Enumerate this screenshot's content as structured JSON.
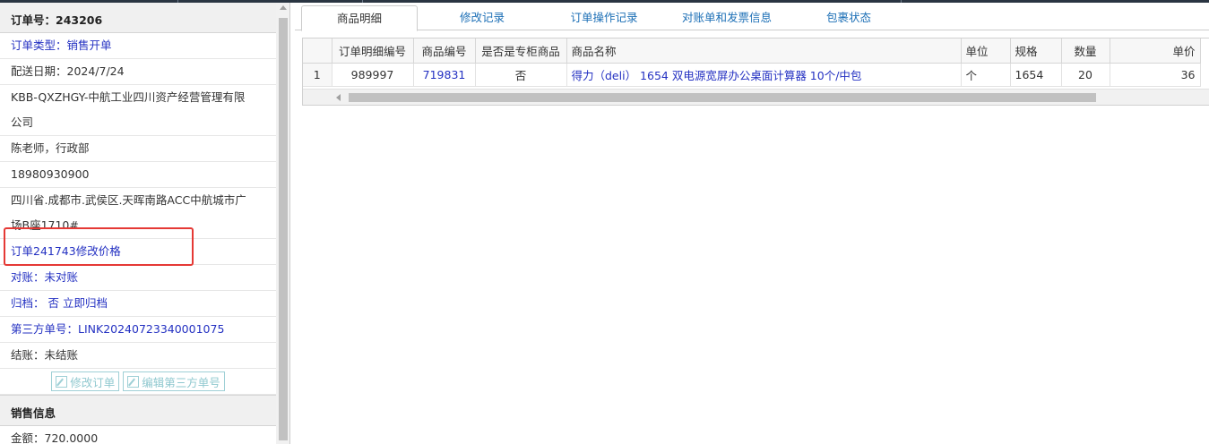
{
  "order": {
    "title": "订单号：243206",
    "type_label": "订单类型：销售开单",
    "delivery_date": "配送日期：2024/7/24",
    "customer_line1": "KBB-QXZHGY-中航工业四川资产经营管理有限",
    "customer_line2": "公司",
    "contact": "陈老师，行政部",
    "phone": "18980930900",
    "address_line1": "四川省.成都市.武侯区.天晖南路ACC中航城市广",
    "address_line2": "场B座1710#",
    "note": "订单241743修改价格",
    "reconcile": "对账：未对账",
    "archive": "归档：  否  立即归档",
    "third_party": "第三方单号：LINK20240723340001075",
    "settle": "结账：未结账",
    "btn_edit_order": "修改订单",
    "btn_edit_third": "编辑第三方单号"
  },
  "sales": {
    "title": "销售信息",
    "amount": "金额：720.0000"
  },
  "tabs": [
    "商品明细",
    "修改记录",
    "订单操作记录",
    "对账单和发票信息",
    "包裹状态"
  ],
  "grid": {
    "headers": [
      "订单明细编号",
      "商品编号",
      "是否是专柜商品",
      "商品名称",
      "单位",
      "规格",
      "数量",
      "单价"
    ],
    "rows": [
      {
        "rn": "1",
        "detail_no": "989997",
        "product_no": "719831",
        "counter": "否",
        "name": "得力（deli） 1654 双电源宽屏办公桌面计算器 10个/中包",
        "unit": "个",
        "spec": "1654",
        "qty": "20",
        "price": "36"
      }
    ]
  },
  "colors": {
    "link": "#2431c2",
    "tab_link": "#1c6fb6",
    "highlight_box": "#e53935"
  }
}
